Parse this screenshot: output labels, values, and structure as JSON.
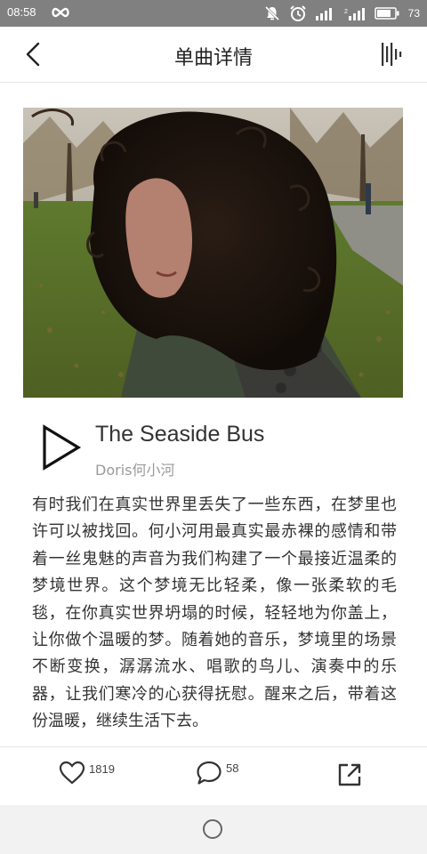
{
  "status_bar": {
    "time": "08:58",
    "battery_level": "73",
    "icons": [
      "infinity-icon",
      "mute-icon",
      "alarm-icon",
      "signal-icon",
      "signal-2-icon",
      "battery-icon"
    ]
  },
  "header": {
    "title": "单曲详情",
    "back_icon": "chevron-left-icon",
    "playing_icon": "sound-bars-icon"
  },
  "cover": {
    "icon": "album-cover-photo"
  },
  "track": {
    "name": "The Seaside Bus",
    "artist": "Doris何小河",
    "play_icon": "play-icon"
  },
  "description": "有时我们在真实世界里丢失了一些东西，在梦里也许可以被找回。何小河用最真实最赤裸的感情和带着一丝鬼魅的声音为我们构建了一个最接近温柔的梦境世界。这个梦境无比轻柔，像一张柔软的毛毯，在你真实世界坍塌的时候，轻轻地为你盖上，让你做个温暖的梦。随着她的音乐，梦境里的场景不断变换，潺潺流水、唱歌的鸟儿、演奏中的乐器，让我们寒冷的心获得抚慰。醒来之后，带着这份温暖，继续生活下去。",
  "actions": {
    "likes": "1819",
    "comments": "58",
    "like_icon": "heart-icon",
    "comment_icon": "comment-bubble-icon",
    "share_icon": "share-icon"
  },
  "nav_bar": {
    "home_icon": "home-circle-icon"
  }
}
